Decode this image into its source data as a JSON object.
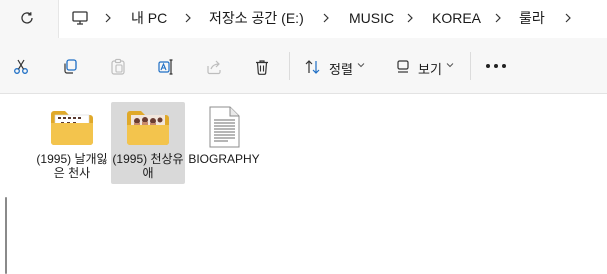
{
  "address_bar": {
    "refresh_icon": "refresh-icon",
    "pc_icon": "monitor-icon",
    "breadcrumb": [
      "내 PC",
      "저장소 공간 (E:)",
      "MUSIC",
      "KOREA",
      "룰라"
    ]
  },
  "toolbar": {
    "cut_icon": "scissors-icon",
    "copy_icon": "copy-icon",
    "paste_icon": "paste-icon",
    "rename_icon": "rename-icon",
    "share_icon": "share-icon",
    "delete_icon": "trash-icon",
    "sort_label": "정렬",
    "view_label": "보기",
    "more_icon": "more-icon"
  },
  "files": [
    {
      "name": "(1995) 날개잃은 천사",
      "type": "folder",
      "selected": false
    },
    {
      "name": "(1995) 천상유애",
      "type": "folder",
      "selected": true
    },
    {
      "name": "BIOGRAPHY",
      "type": "document",
      "selected": false
    }
  ],
  "colors": {
    "folder": "#f3c44d",
    "folder_dark": "#e0a92a",
    "selection": "#d9d9d9",
    "toolbar_bg": "#f7f7f7"
  }
}
